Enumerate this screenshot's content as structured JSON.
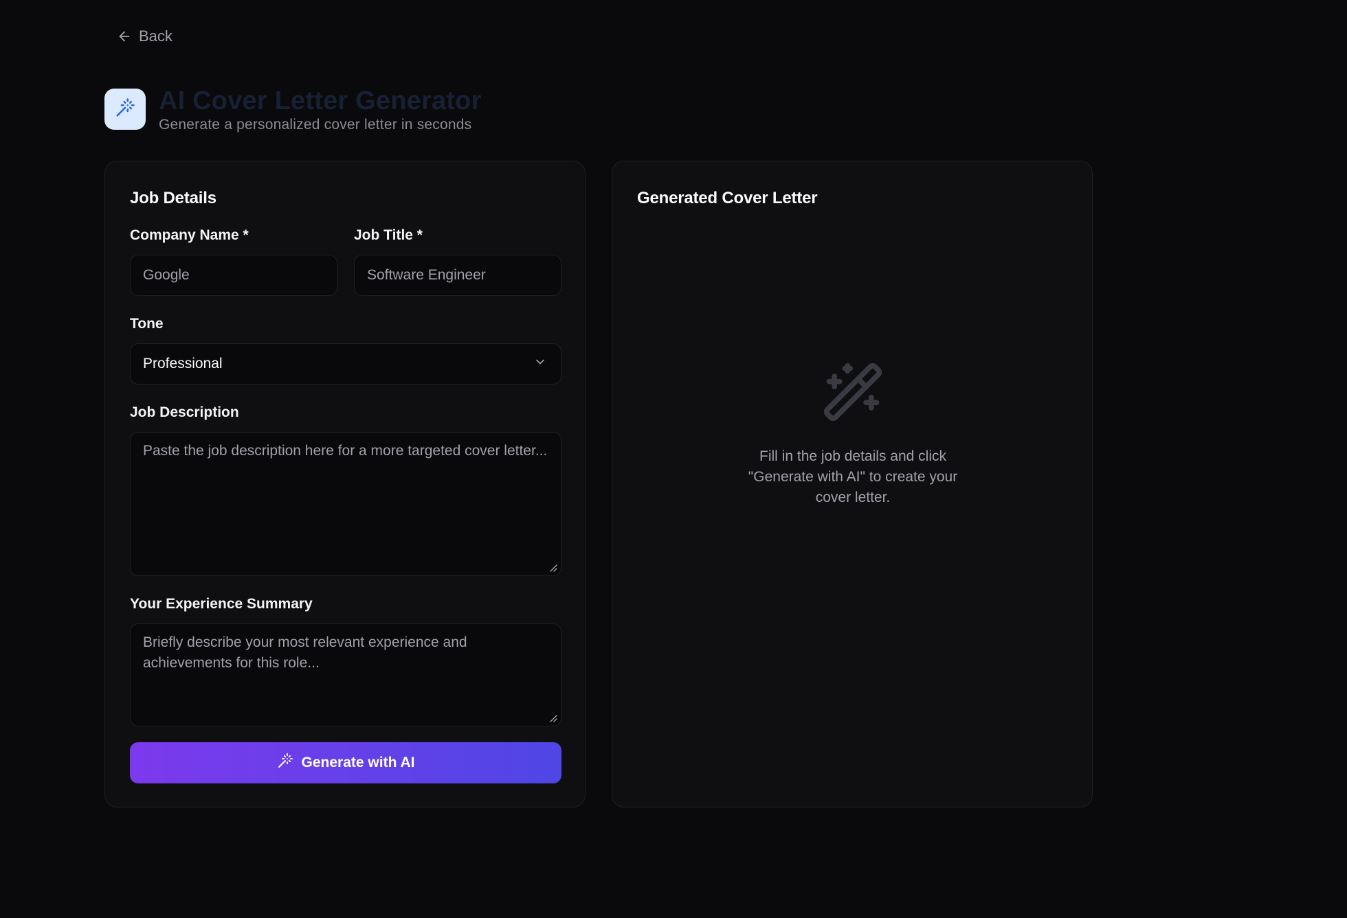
{
  "nav": {
    "back_label": "Back"
  },
  "header": {
    "title": "AI Cover Letter Generator",
    "subtitle": "Generate a personalized cover letter in seconds"
  },
  "form": {
    "title": "Job Details",
    "company": {
      "label": "Company Name *",
      "placeholder": "Google",
      "value": ""
    },
    "job_title": {
      "label": "Job Title *",
      "placeholder": "Software Engineer",
      "value": ""
    },
    "tone": {
      "label": "Tone",
      "selected": "Professional"
    },
    "job_description": {
      "label": "Job Description",
      "placeholder": "Paste the job description here for a more targeted cover letter..."
    },
    "experience": {
      "label": "Your Experience Summary",
      "placeholder": "Briefly describe your most relevant experience and achievements for this role..."
    },
    "generate_label": "Generate with AI"
  },
  "output": {
    "title": "Generated Cover Letter",
    "empty_message": "Fill in the job details and click \"Generate with AI\" to create your cover letter."
  },
  "colors": {
    "background": "#0a0a0c",
    "card": "#0f0f12",
    "accent_start": "#7c3aed",
    "accent_end": "#4f46e5",
    "icon_tile": "#dbeafe",
    "icon_blue": "#2563eb"
  },
  "icons": {
    "back": "arrow-left-icon",
    "header": "magic-wand-icon",
    "select": "chevron-down-icon",
    "button": "magic-wand-icon",
    "empty_state": "magic-wand-icon"
  }
}
